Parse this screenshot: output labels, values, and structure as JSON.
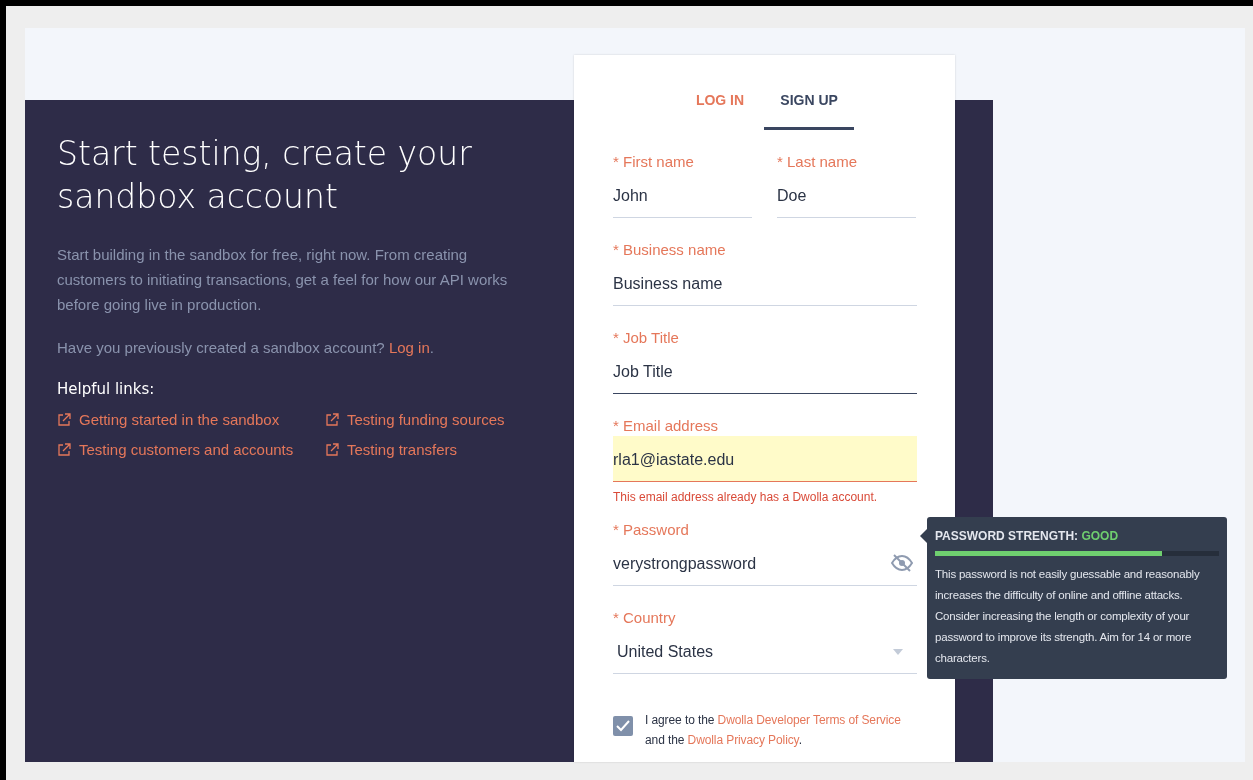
{
  "intro": {
    "heading": "Start testing, create your sandbox account",
    "description": "Start building in the sandbox for free, right now. From creating customers to initiating transactions, get a feel for how our API works before going live in production.",
    "login_prompt": "Have you previously created a sandbox account?",
    "login_link": "Log in",
    "login_suffix": ".",
    "links_heading": "Helpful links:",
    "links": [
      {
        "label": "Getting started in the sandbox"
      },
      {
        "label": "Testing funding sources"
      },
      {
        "label": "Testing customers and accounts"
      },
      {
        "label": "Testing transfers"
      }
    ]
  },
  "tabs": [
    {
      "label": "LOG IN",
      "selected": false
    },
    {
      "label": "SIGN UP",
      "selected": true
    }
  ],
  "name_fields": [
    {
      "label": "* First name",
      "value": "John"
    },
    {
      "label": "* Last name",
      "value": "Doe"
    }
  ],
  "fields": [
    {
      "kind": "text",
      "label": "* Business name",
      "value": "Business name",
      "focused": false
    },
    {
      "kind": "text",
      "label": "* Job Title",
      "value": "Job Title",
      "focused": true
    },
    {
      "kind": "text",
      "label": "* Email address",
      "value": "rla1@iastate.edu",
      "focused": false,
      "error": "This email address already has a Dwolla account."
    },
    {
      "kind": "password",
      "label": "* Password",
      "value": "verystrongpassword",
      "focused": false
    },
    {
      "kind": "select",
      "label": "* Country",
      "value": "United States",
      "focused": false
    }
  ],
  "agreement": {
    "checked": true,
    "text_before": "I agree to the",
    "terms_link": "Dwolla Developer Terms of Service",
    "text_middle": "and the",
    "privacy_link": "Dwolla Privacy Policy",
    "text_after": "."
  },
  "strength_tooltip": {
    "title": "PASSWORD STRENGTH:",
    "rating": "GOOD",
    "level": 0.8,
    "description": "This password is not easily guessable and reasonably increases the difficulty of online and offline attacks. Consider increasing the length or complexity of your password to improve its strength. Aim for 14 or more characters."
  }
}
